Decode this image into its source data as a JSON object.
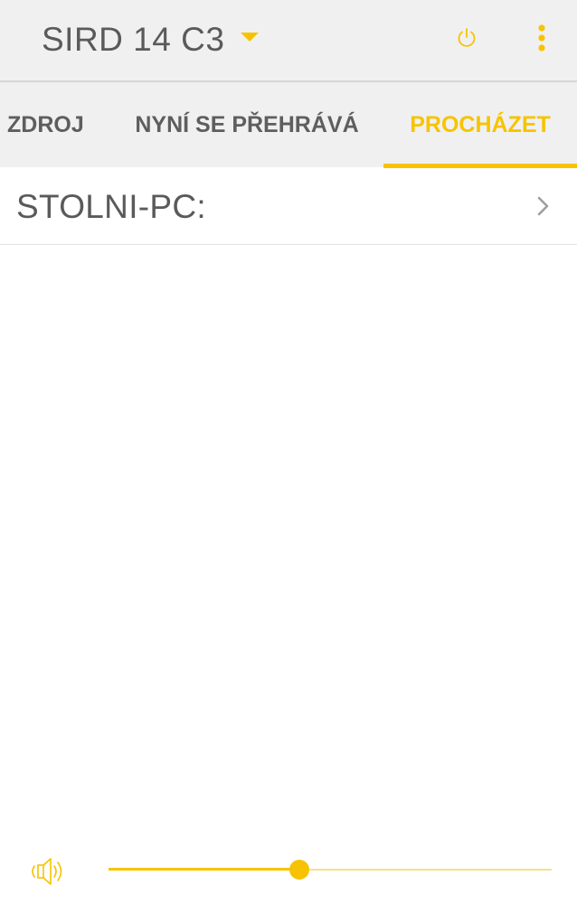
{
  "appbar": {
    "device_name": "SIRD 14 C3",
    "dropdown_icon": "caret-down-icon",
    "power_icon": "power-icon",
    "more_icon": "more-vert-icon"
  },
  "tabs": [
    {
      "label": "ZDROJ",
      "selected": false
    },
    {
      "label": "NYNÍ SE PŘEHRÁVÁ",
      "selected": false
    },
    {
      "label": "PROCHÁZET",
      "selected": true
    }
  ],
  "browse": {
    "items": [
      {
        "label": "STOLNI-PC:",
        "icon": "chevron-right-icon"
      }
    ]
  },
  "volume": {
    "icon": "volume-icon",
    "level": 0.43
  },
  "colors": {
    "accent": "#f7c300",
    "accent_light": "#f7e08a",
    "text_primary": "#5a5a5a",
    "bar_background": "#f0f0f0",
    "chevron": "#9e9e9e"
  }
}
